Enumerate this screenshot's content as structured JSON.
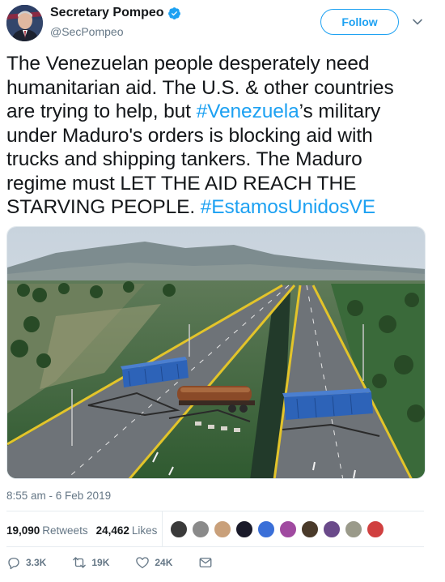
{
  "author": {
    "display_name": "Secretary Pompeo",
    "handle": "@SecPompeo",
    "verified": true
  },
  "follow_label": "Follow",
  "tweet": {
    "segments": [
      {
        "text": "The Venezuelan people desperately need humanitarian aid. The U.S. & other countries are trying to help, but ",
        "type": "text"
      },
      {
        "text": "#Venezuela",
        "type": "hashtag"
      },
      {
        "text": "’s military under Maduro's orders is blocking aid with trucks and shipping tankers. The Maduro regime must LET THE AID REACH THE STARVING PEOPLE. ",
        "type": "text"
      },
      {
        "text": "#EstamosUnidosVE",
        "type": "hashtag"
      }
    ]
  },
  "media": {
    "icon": "photo-bridge-blockade"
  },
  "timestamp": "8:55 am - 6 Feb 2019",
  "stats": {
    "retweets_count": "19,090",
    "retweets_label": "Retweets",
    "likes_count": "24,462",
    "likes_label": "Likes"
  },
  "likers": [
    {
      "color": "#3a3a3a"
    },
    {
      "color": "#8a8a8a"
    },
    {
      "color": "#c9a07a"
    },
    {
      "color": "#1a1a2a"
    },
    {
      "color": "#3a6fd8"
    },
    {
      "color": "#a04aa0"
    },
    {
      "color": "#4a3a2a"
    },
    {
      "color": "#6a4a8a"
    },
    {
      "color": "#9a9a8a"
    },
    {
      "color": "#d04040"
    }
  ],
  "actions": {
    "reply_count": "3.3K",
    "retweet_count": "19K",
    "like_count": "24K"
  },
  "colors": {
    "accent": "#1da1f2",
    "muted": "#657786",
    "text": "#14171a"
  }
}
